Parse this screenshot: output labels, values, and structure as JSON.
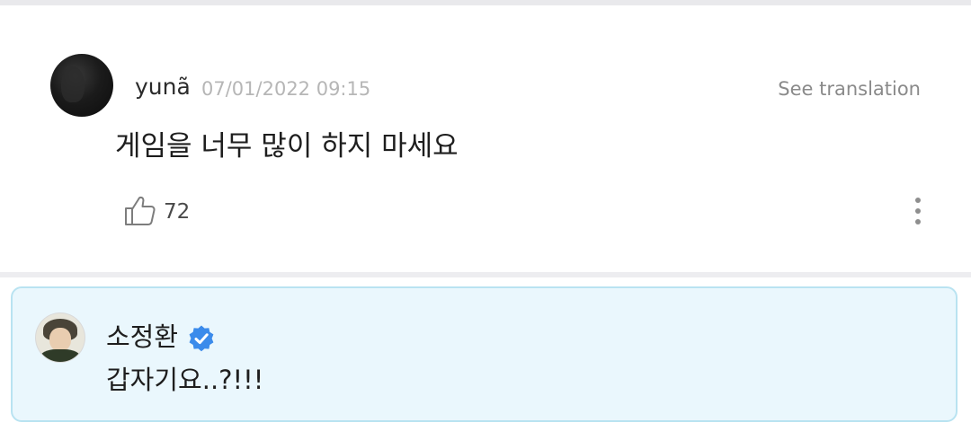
{
  "comment": {
    "username": "yunã",
    "timestamp": "07/01/2022 09:15",
    "translate_label": "See translation",
    "text": "게임을 너무 많이 하지 마세요",
    "like_count": "72",
    "avatar_icon": "user-avatar",
    "like_icon": "thumbs-up-icon",
    "more_icon": "more-vertical-icon"
  },
  "reply": {
    "author": "소정환",
    "verified": true,
    "verified_icon": "verified-badge-icon",
    "verified_color": "#3b8beb",
    "text": "갑자기요..?!!!",
    "background_color": "#eaf7fd",
    "border_color": "#b9e3f1"
  }
}
